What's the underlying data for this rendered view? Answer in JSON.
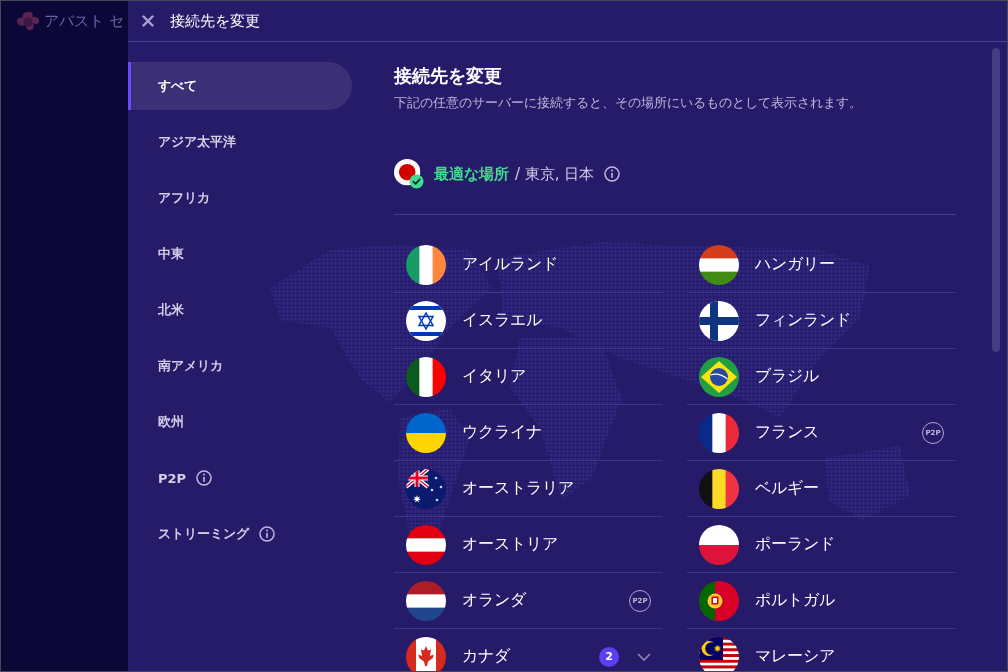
{
  "background_app": {
    "title": "アバスト セ"
  },
  "header": {
    "title": "接続先を変更"
  },
  "sidebar": {
    "items": [
      {
        "label": "すべて",
        "selected": true,
        "info": false
      },
      {
        "label": "アジア太平洋",
        "selected": false,
        "info": false
      },
      {
        "label": "アフリカ",
        "selected": false,
        "info": false
      },
      {
        "label": "中東",
        "selected": false,
        "info": false
      },
      {
        "label": "北米",
        "selected": false,
        "info": false
      },
      {
        "label": "南アメリカ",
        "selected": false,
        "info": false
      },
      {
        "label": "欧州",
        "selected": false,
        "info": false
      },
      {
        "label": "P2P",
        "selected": false,
        "info": true
      },
      {
        "label": "ストリーミング",
        "selected": false,
        "info": true
      }
    ]
  },
  "content": {
    "title": "接続先を変更",
    "subtitle": "下記の任意のサーバーに接続すると、その場所にいるものとして表示されます。",
    "best_location": {
      "label": "最適な場所",
      "location": "/ 東京, 日本",
      "kind": "japan"
    },
    "countries": [
      {
        "name": "アイルランド",
        "kind": "ireland"
      },
      {
        "name": "イスラエル",
        "kind": "israel"
      },
      {
        "name": "イタリア",
        "kind": "italy"
      },
      {
        "name": "ウクライナ",
        "kind": "ukraine"
      },
      {
        "name": "オーストラリア",
        "kind": "australia"
      },
      {
        "name": "オーストリア",
        "kind": "austria"
      },
      {
        "name": "オランダ",
        "kind": "netherlands",
        "tags": [
          "P2P"
        ]
      },
      {
        "name": "カナダ",
        "kind": "canada",
        "count": "2",
        "expanded": false
      },
      {
        "name": "ハンガリー",
        "kind": "hungary"
      },
      {
        "name": "フィンランド",
        "kind": "finland"
      },
      {
        "name": "ブラジル",
        "kind": "brazil"
      },
      {
        "name": "フランス",
        "kind": "france",
        "tags": [
          "P2P"
        ]
      },
      {
        "name": "ベルギー",
        "kind": "belgium"
      },
      {
        "name": "ポーランド",
        "kind": "poland"
      },
      {
        "name": "ポルトガル",
        "kind": "portugal"
      },
      {
        "name": "マレーシア",
        "kind": "malaysia"
      }
    ]
  }
}
